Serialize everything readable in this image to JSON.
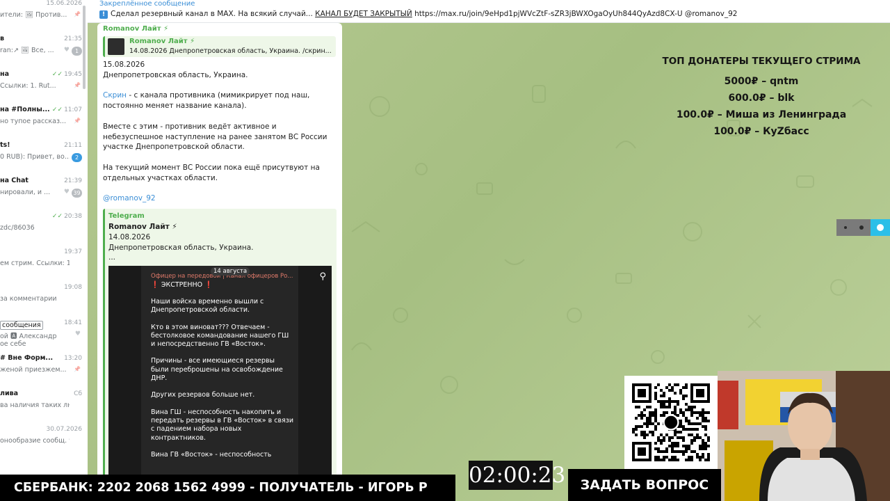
{
  "sidebar": {
    "chats": [
      {
        "name": "",
        "time": "15.06.2026",
        "preview": "ители: 🖼 Против...",
        "badge": "",
        "pinned": true
      },
      {
        "name": "в",
        "time": "21:35",
        "preview": "ran:↗ 🖼 Все, ...",
        "badge": "1",
        "badge_color": "#b8bcc0",
        "heart": true
      },
      {
        "name": "на",
        "time": "19:45",
        "preview": "Ссылки: 1. Rut...",
        "badge": "",
        "pinned": true,
        "check": true
      },
      {
        "name": "на #Полны...",
        "time": "11:07",
        "preview": "но тупое рассказ...",
        "badge": "",
        "pinned": true,
        "check": true
      },
      {
        "name": "ts!",
        "time": "21:11",
        "preview": "0 RUB): Привет, во...",
        "badge": "2",
        "badge_color": "#3a9be0"
      },
      {
        "name": "на Chat",
        "time": "21:39",
        "preview": "нировали, и ...",
        "badge": "39",
        "badge_color": "#b8bcc0",
        "heart": true
      },
      {
        "name": "",
        "time": "20:38",
        "preview": "zdc/86036",
        "badge": "",
        "check": true
      },
      {
        "name": "",
        "time": "19:37",
        "preview": "ем стрим. Ссылки: 1...",
        "badge": ""
      },
      {
        "name": "",
        "time": "19:08",
        "preview": "за комментарии",
        "badge": ""
      },
      {
        "name": "сообщения",
        "time": "18:41",
        "preview": "ой  🅰 Александр",
        "preview2": "ое себе",
        "badge": "",
        "heart": true
      },
      {
        "name": "# Вне Форм...",
        "time": "13:20",
        "preview": "женой приезжем...",
        "badge": "",
        "pinned": true
      },
      {
        "name": "лива",
        "time": "Сб",
        "preview": "ва наличия таких люд...",
        "badge": ""
      },
      {
        "name": "",
        "time": "30.07.2026",
        "preview": "онообразие сообщ. 9...",
        "badge": ""
      }
    ]
  },
  "pinned": {
    "title": "Закреплённое сообщение",
    "text_main": "Сделал резервный канал в MAX.  На всякий случай...",
    "text_caps": "КАНАЛ БУДЕТ ЗАКРЫТЫЙ",
    "text_tail": " https://max.ru/join/9eHpd1pjWVcZtF-sZR3jBWXOgaOyUh844QyAzd8CX-U  @romanov_92",
    "icon": "exclamation-icon"
  },
  "message": {
    "sender": "Romanov Лайт ⚡",
    "reply_name": "Romanov Лайт ⚡",
    "reply_text": "14.08.2026 Днепропетровская область, Украина.  /скрин...",
    "date_line": "15.08.2026",
    "region_line": "Днепропетровская область, Украина.",
    "p1_link": "Скрин",
    "p1": " - с канала противника (мимикрирует под наш, постоянно меняет название канала).",
    "p2": "Вместе с этим - противник ведёт активное и небезуспешное наступление на ранее занятом ВС России участке Днепропетровской области.",
    "p3": "На текущий момент ВС России пока ещё присутвуют на отдельных участках области.",
    "signature": "@romanov_92",
    "forward": {
      "source": "Telegram",
      "name": "Romanov Лайт ⚡",
      "date": "14.08.2026",
      "region": "Днепропетровская область, Украина.",
      "ellipsis": "...",
      "screenshot": {
        "date_badge": "14 августа",
        "header": "Офицер на передовой | Канал офицеров Ро...",
        "urgent": "❗ ЭКСТРЕННО ❗",
        "paragraphs": [
          "Наши войска временно вышли с Днепропетровской области.",
          "Кто в этом виноват??? Отвечаем - бестолковое командование нашего ГШ и непосредственно ГВ «Восток».",
          "Причины - все имеющиеся резервы были переброшены на освобождение ДНР.",
          "Других резервов больше нет.",
          "Вина ГШ - неспособность накопить и передать резервы в ГВ «Восток» в связи с падением набора новых контрактников.",
          "Вина ГВ «Восток» - неспособность"
        ]
      }
    }
  },
  "donors": {
    "title": "ТОП ДОНАТЕРЫ ТЕКУЩЕГО СТРИМА",
    "rows": [
      "5000₽ – qntm",
      "600.0₽ – blk",
      "100.0₽ – Миша из Ленинграда",
      "100.0₽ – КуZбасс"
    ]
  },
  "stream": {
    "timer": "02:00:23",
    "bank_line": "СБЕРБАНК: 2202 2068 1562 4999 - ПОЛУЧАТЕЛЬ - ИГОРЬ Р",
    "ask_label": "ЗАДАТЬ ВОПРОС"
  },
  "colors": {
    "accent": "#3a8ed6",
    "green_name": "#4fae4e",
    "chat_bg": "#a6bf82"
  }
}
